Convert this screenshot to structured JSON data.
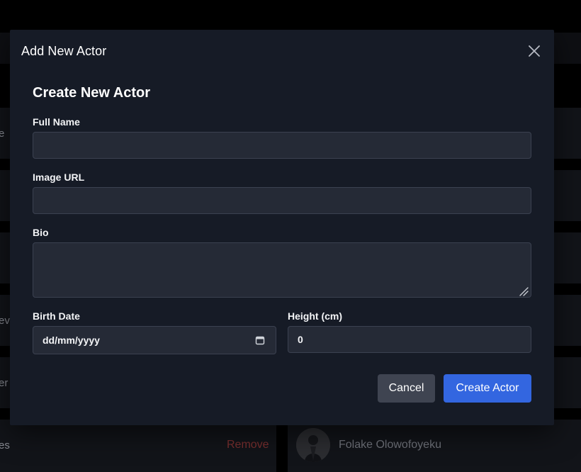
{
  "background": {
    "edge_texts": [
      "e",
      "ev",
      "er",
      "es"
    ],
    "remove_label": "Remove",
    "actor_name": "Folake Olowofoyeku"
  },
  "modal": {
    "title": "Add New Actor",
    "form_heading": "Create New Actor",
    "fields": {
      "full_name": {
        "label": "Full Name",
        "value": ""
      },
      "image_url": {
        "label": "Image URL",
        "value": ""
      },
      "bio": {
        "label": "Bio",
        "value": ""
      },
      "birth_date": {
        "label": "Birth Date",
        "placeholder": "dd/mm/yyyy"
      },
      "height": {
        "label": "Height (cm)",
        "value": "0"
      }
    },
    "buttons": {
      "cancel": "Cancel",
      "create": "Create Actor"
    }
  },
  "icons": {
    "close": "close-icon",
    "calendar": "calendar-icon",
    "resize": "resize-grip-icon"
  },
  "colors": {
    "modal_bg": "#161b26",
    "input_bg": "#252a36",
    "primary": "#3366e0",
    "secondary": "#3f4451",
    "danger_text": "#7a2f2f"
  }
}
